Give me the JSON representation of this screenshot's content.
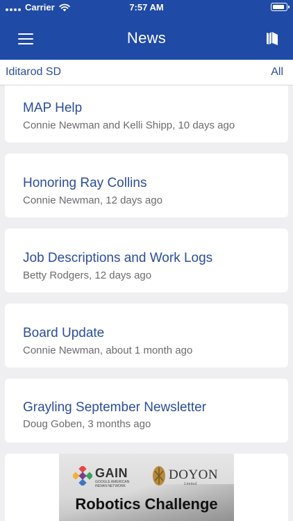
{
  "status_bar": {
    "carrier": "Carrier",
    "time": "7:57 AM"
  },
  "nav": {
    "title": "News"
  },
  "filter": {
    "district": "Iditarod SD",
    "all_label": "All"
  },
  "news": [
    {
      "title": "MAP Help",
      "meta": "Connie Newman and Kelli Shipp, 10 days ago"
    },
    {
      "title": "Honoring Ray Collins",
      "meta": "Connie Newman, 12 days ago"
    },
    {
      "title": "Job Descriptions and Work Logs",
      "meta": "Betty Rodgers, 12 days ago"
    },
    {
      "title": "Board Update",
      "meta": "Connie Newman, about 1 month ago"
    },
    {
      "title": "Grayling September Newsletter",
      "meta": "Doug Goben, 3 months ago"
    }
  ],
  "banner": {
    "gain_name": "GAIN",
    "gain_subtitle": "GOOGLE AMERICAN INDIAN NETWORK",
    "doyon_name": "DOYON",
    "doyon_subtitle": "Limited",
    "headline": "Robotics Challenge"
  },
  "colors": {
    "brand_blue": "#1f4aa6",
    "link_blue": "#2b4d9a",
    "background": "#efeff2"
  }
}
